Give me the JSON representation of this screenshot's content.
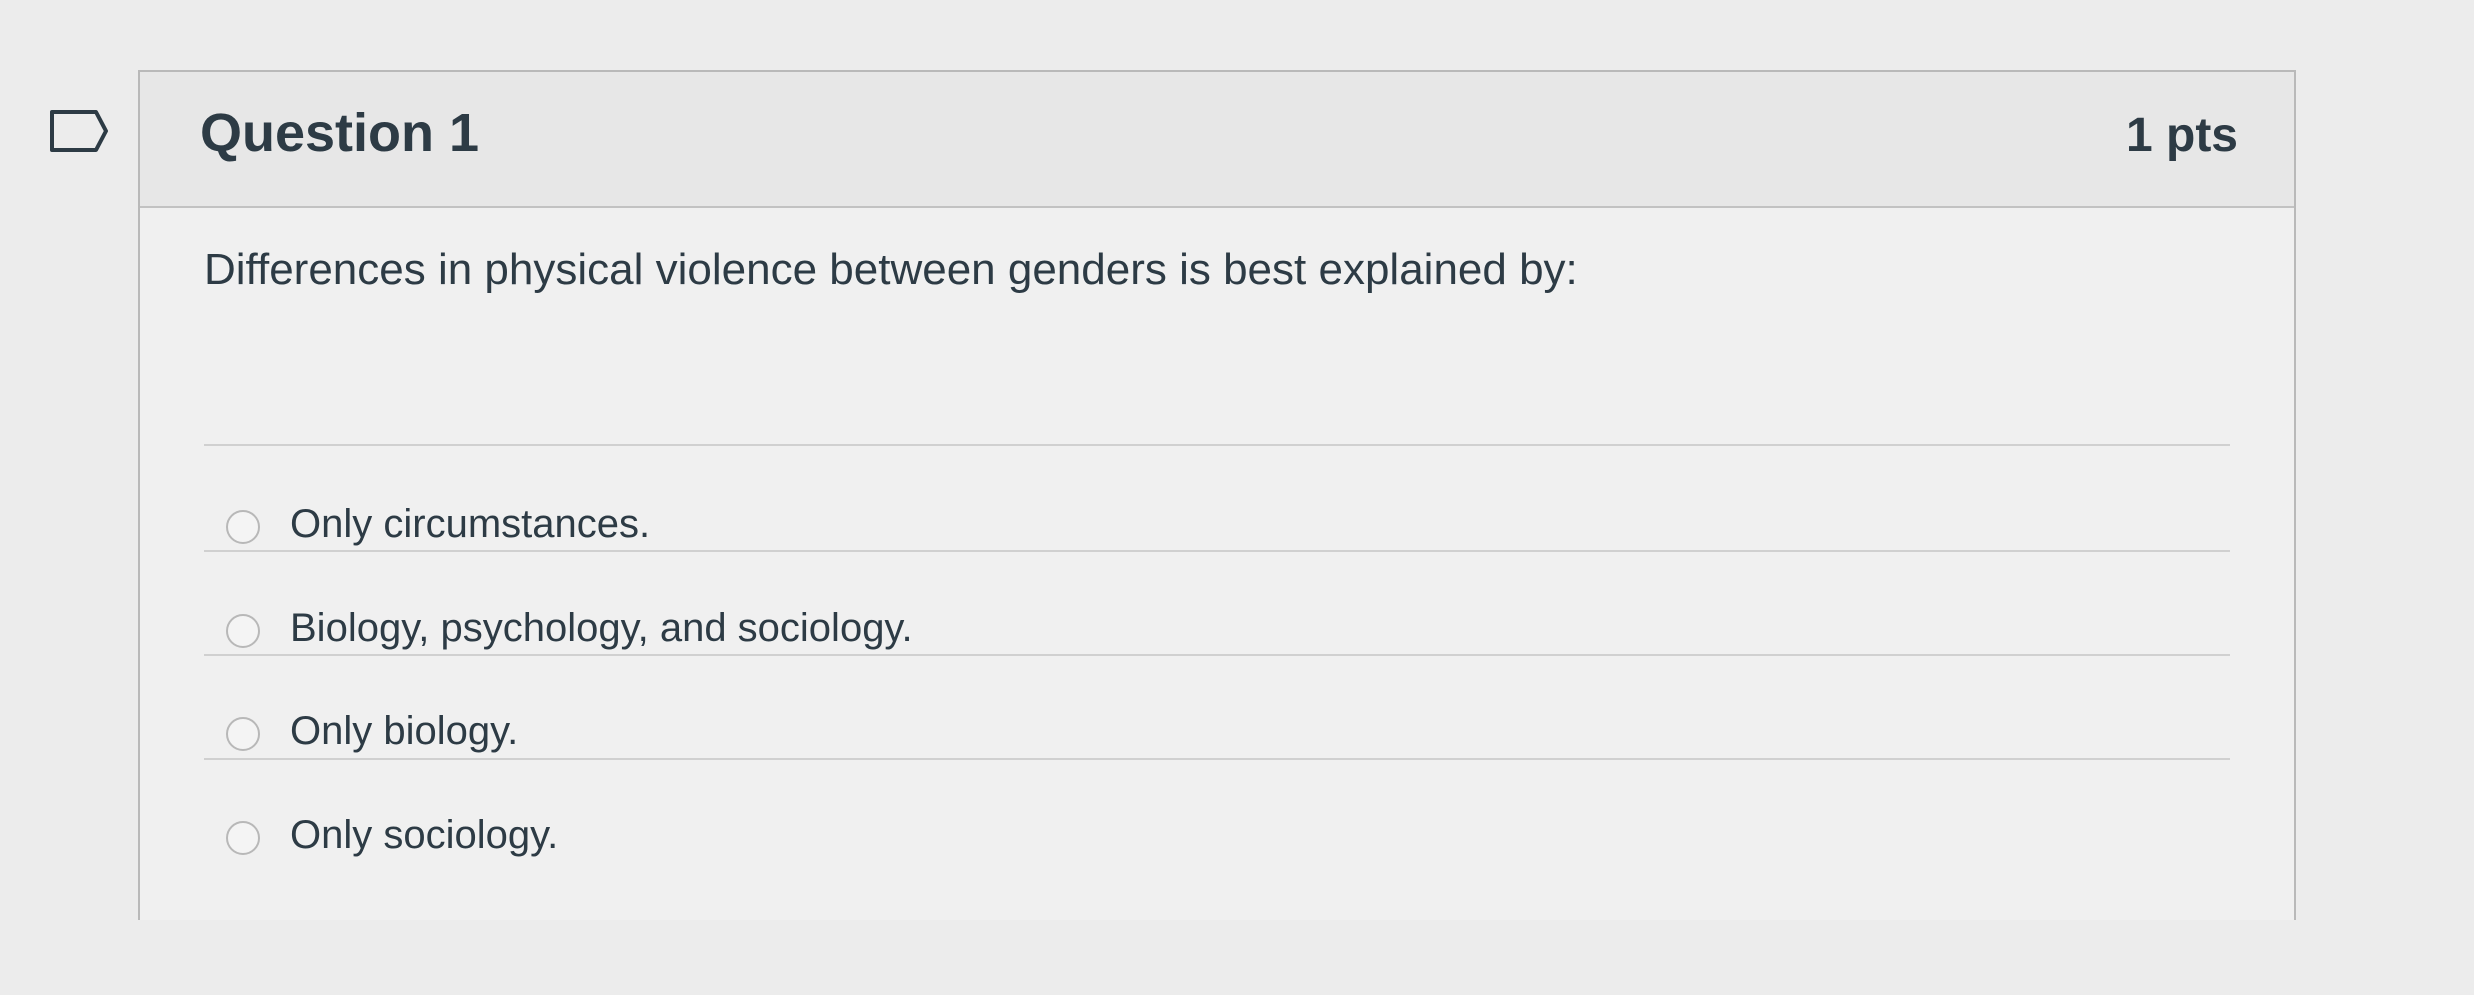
{
  "question": {
    "title": "Question 1",
    "points": "1 pts",
    "text": "Differences in physical violence between genders is best explained by:",
    "options": [
      "Only circumstances.",
      "Biology, psychology, and sociology.",
      "Only biology.",
      "Only sociology."
    ]
  },
  "colors": {
    "page_background": "#ececec",
    "card_border": "#b9b9b9",
    "text": "#2d3b45"
  },
  "icons": {
    "flag": "flag-outline-icon",
    "radio": "radio-unselected"
  }
}
